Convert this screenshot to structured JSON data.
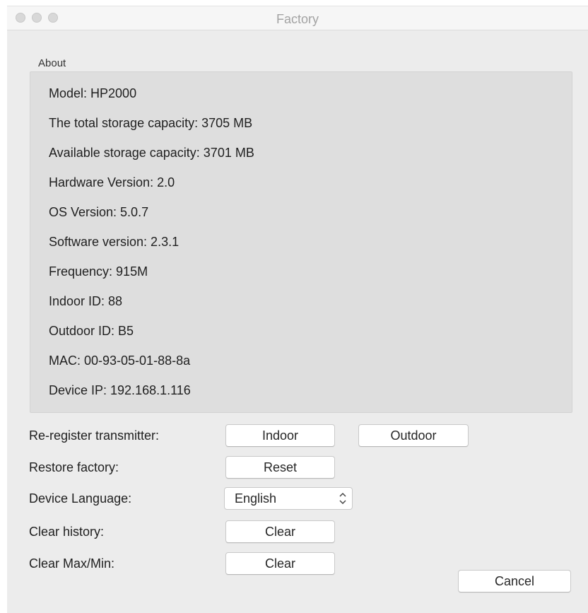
{
  "window": {
    "title": "Factory"
  },
  "about": {
    "label": "About",
    "lines": [
      "Model: HP2000",
      "The total storage capacity: 3705 MB",
      "Available storage capacity: 3701 MB",
      "Hardware Version: 2.0",
      "OS Version: 5.0.7",
      "Software version: 2.3.1",
      "Frequency: 915M",
      "Indoor ID: 88",
      "Outdoor ID: B5",
      "MAC: 00-93-05-01-88-8a",
      "Device IP: 192.168.1.116"
    ]
  },
  "controls": {
    "reregister_label": "Re-register transmitter:",
    "indoor_button": "Indoor",
    "outdoor_button": "Outdoor",
    "restore_label": "Restore factory:",
    "reset_button": "Reset",
    "language_label": "Device Language:",
    "language_value": "English",
    "clear_history_label": "Clear history:",
    "clear_history_button": "Clear",
    "clear_maxmin_label": "Clear Max/Min:",
    "clear_maxmin_button": "Clear",
    "cancel_button": "Cancel"
  },
  "icons": {
    "window_controls": [
      "close-icon",
      "minimize-icon",
      "zoom-icon"
    ],
    "select_arrows": "chevron-up-down-icon"
  },
  "colors": {
    "window_bg": "#ececec",
    "group_bg": "#dedede",
    "title_text": "#a3a3a3"
  }
}
